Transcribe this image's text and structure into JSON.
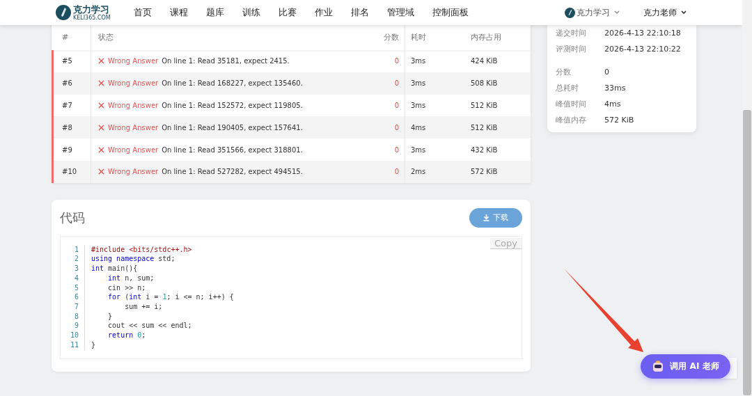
{
  "nav": {
    "logo_title": "克力学习",
    "logo_domain": "KELI365.COM",
    "items": [
      {
        "label": "首页",
        "selected": false
      },
      {
        "label": "课程",
        "selected": false
      },
      {
        "label": "题库",
        "selected": false
      },
      {
        "label": "训练",
        "selected": false
      },
      {
        "label": "比赛",
        "selected": false
      },
      {
        "label": "作业",
        "selected": false
      },
      {
        "label": "排名",
        "selected": false
      },
      {
        "label": "管理域",
        "selected": false
      },
      {
        "label": "控制面板",
        "selected": false
      }
    ],
    "domain_menu": "克力学习",
    "user_menu": "克力老师"
  },
  "table": {
    "columns": [
      "#",
      "状态",
      "分数",
      "耗时",
      "内存占用"
    ],
    "rows": [
      {
        "id": "#5",
        "kind": "wrong",
        "verdict": "Wrong Answer",
        "message": "On line 1: Read 35181, expect 2415.",
        "score": "0",
        "time": "3ms",
        "memory": "424 KiB"
      },
      {
        "id": "#6",
        "kind": "wrong",
        "verdict": "Wrong Answer",
        "message": "On line 1: Read 168227, expect 135460.",
        "score": "0",
        "time": "3ms",
        "memory": "508 KiB"
      },
      {
        "id": "#7",
        "kind": "wrong",
        "verdict": "Wrong Answer",
        "message": "On line 1: Read 152572, expect 119805.",
        "score": "0",
        "time": "3ms",
        "memory": "512 KiB"
      },
      {
        "id": "#8",
        "kind": "wrong",
        "verdict": "Wrong Answer",
        "message": "On line 1: Read 190405, expect 157641.",
        "score": "0",
        "time": "4ms",
        "memory": "512 KiB"
      },
      {
        "id": "#9",
        "kind": "wrong",
        "verdict": "Wrong Answer",
        "message": "On line 1: Read 351566, expect 318801.",
        "score": "0",
        "time": "3ms",
        "memory": "432 KiB"
      },
      {
        "id": "#10",
        "kind": "wrong",
        "verdict": "Wrong Answer",
        "message": "On line 1: Read 527282, expect 494515.",
        "score": "0",
        "time": "2ms",
        "memory": "572 KiB"
      }
    ]
  },
  "info": {
    "groups": [
      [
        {
          "label": "递交时间",
          "value": "2026-4-13 22:10:18"
        },
        {
          "label": "评测时间",
          "value": "2026-4-13 22:10:22"
        }
      ],
      [
        {
          "label": "分数",
          "value": "0"
        },
        {
          "label": "总耗时",
          "value": "33ms"
        },
        {
          "label": "峰值时间",
          "value": "4ms"
        },
        {
          "label": "峰值内存",
          "value": "572 KiB"
        }
      ]
    ]
  },
  "code": {
    "title": "代码",
    "download": "下载",
    "copy": "Copy",
    "lines": [
      {
        "no": "1",
        "tokens": [
          {
            "kind": "pre",
            "t": "#include"
          },
          {
            "kind": "str",
            "t": " <bits/stdc++.h>"
          }
        ]
      },
      {
        "no": "2",
        "tokens": [
          {
            "kind": "kw",
            "t": "using namespace"
          },
          {
            "kind": "plain",
            "t": " std;"
          }
        ]
      },
      {
        "no": "3",
        "tokens": [
          {
            "kind": "kw",
            "t": "int"
          },
          {
            "kind": "plain",
            "t": " main(){"
          }
        ]
      },
      {
        "no": "4",
        "tokens": [
          {
            "kind": "kw",
            "t": "    int"
          },
          {
            "kind": "plain",
            "t": " n, sum;"
          }
        ]
      },
      {
        "no": "5",
        "tokens": [
          {
            "kind": "plain",
            "t": "    cin >> n;"
          }
        ]
      },
      {
        "no": "6",
        "tokens": [
          {
            "kind": "kw",
            "t": "    for"
          },
          {
            "kind": "plain",
            "t": " ("
          },
          {
            "kind": "kw",
            "t": "int"
          },
          {
            "kind": "plain",
            "t": " i = "
          },
          {
            "kind": "num",
            "t": "1"
          },
          {
            "kind": "plain",
            "t": "; i <= n; i++) {"
          }
        ]
      },
      {
        "no": "7",
        "tokens": [
          {
            "kind": "plain",
            "t": "        sum += i;"
          }
        ]
      },
      {
        "no": "8",
        "tokens": [
          {
            "kind": "plain",
            "t": "    }"
          }
        ]
      },
      {
        "no": "9",
        "tokens": [
          {
            "kind": "plain",
            "t": "    cout << sum << endl;"
          }
        ]
      },
      {
        "no": "10",
        "tokens": [
          {
            "kind": "kw",
            "t": "    return "
          },
          {
            "kind": "num",
            "t": "0"
          },
          {
            "kind": "plain",
            "t": ";"
          }
        ]
      },
      {
        "no": "11",
        "tokens": [
          {
            "kind": "plain",
            "t": "}"
          }
        ]
      }
    ]
  },
  "ai_button": "调用 AI 老师"
}
